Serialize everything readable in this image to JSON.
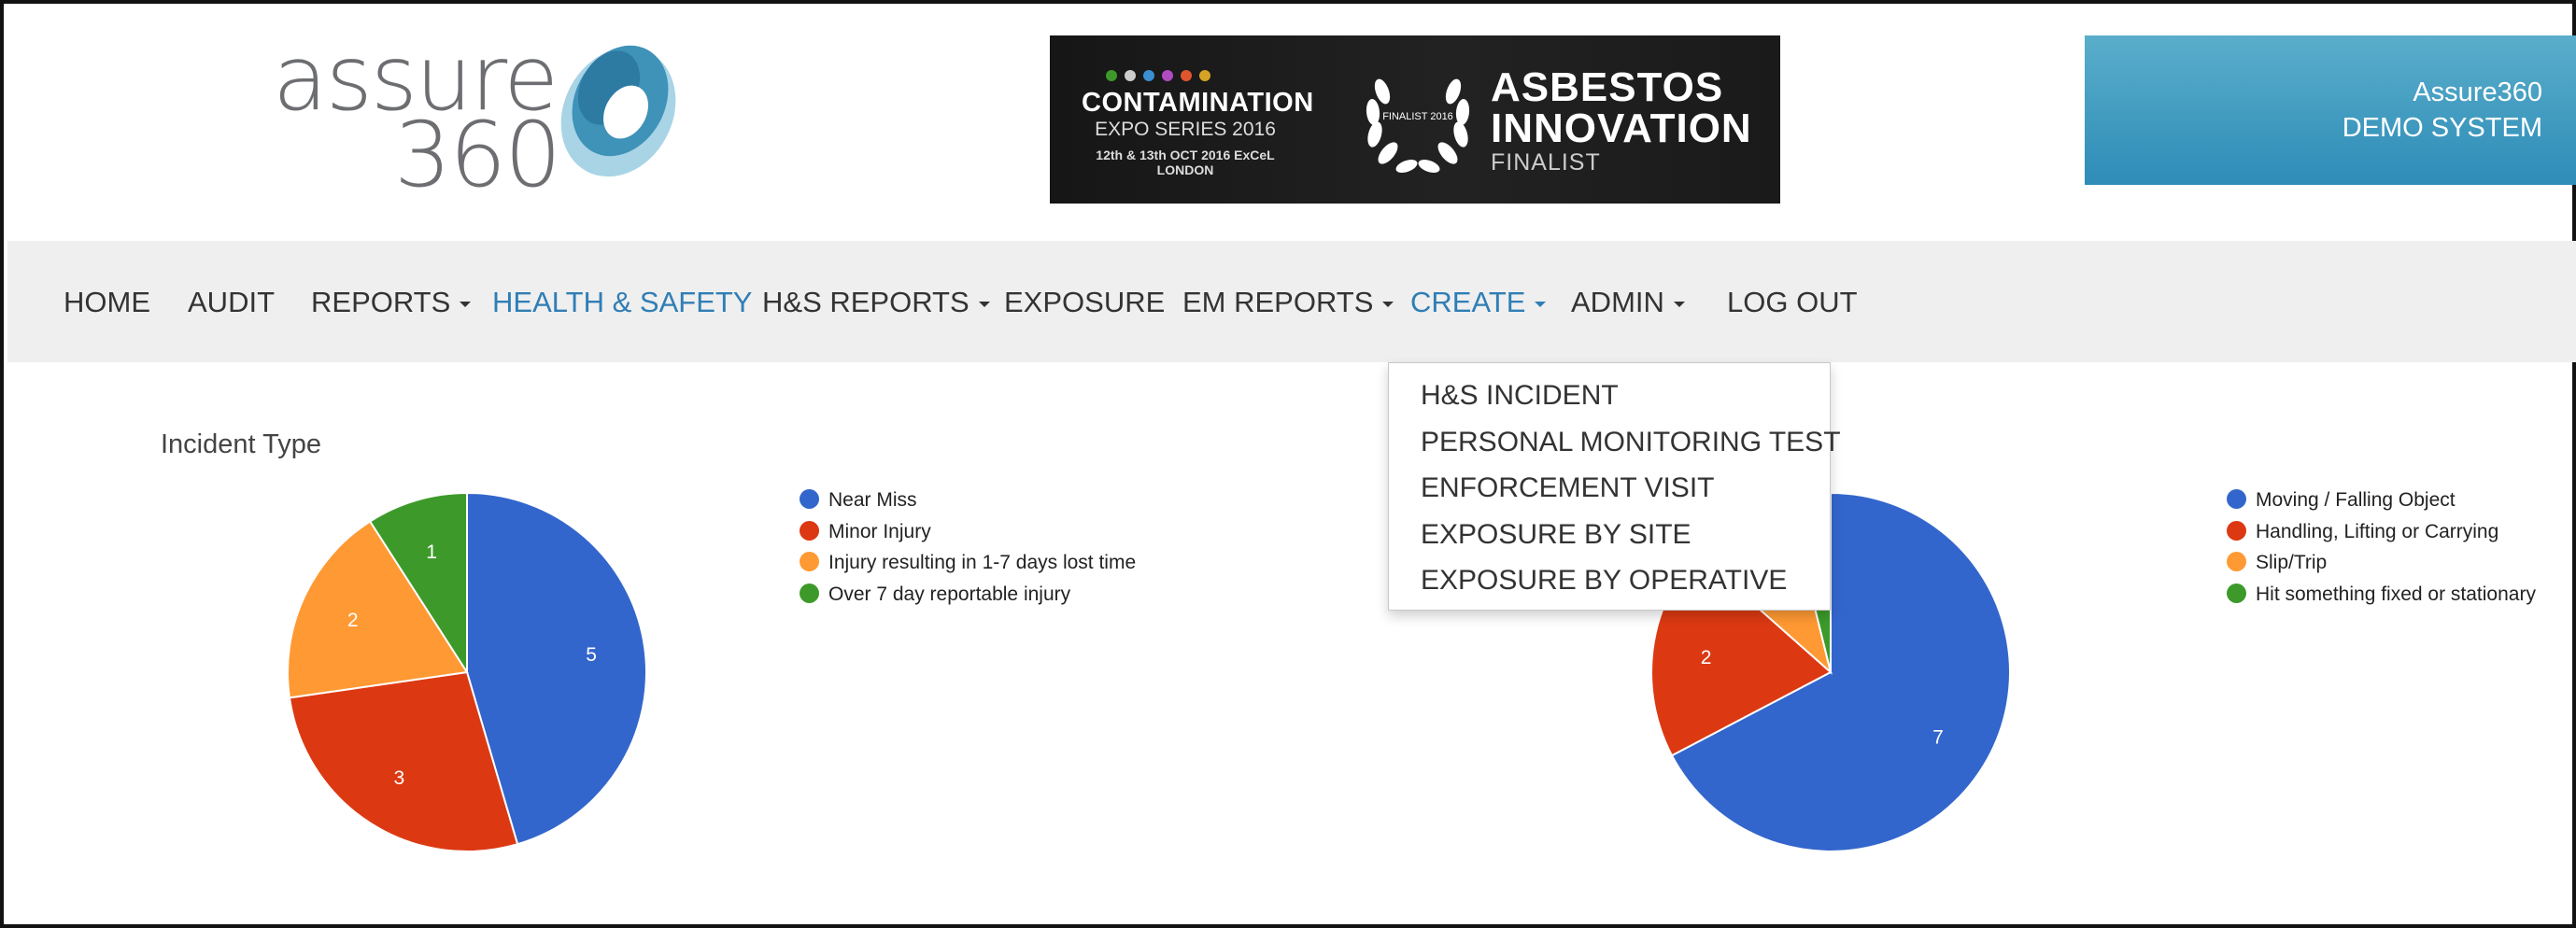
{
  "header": {
    "logo_word": "assure",
    "logo_number": "360",
    "banner": {
      "expo_line1": "CONTAMINATION",
      "expo_line2": "EXPO SERIES 2016",
      "expo_line3": "12th & 13th OCT 2016 ExCeL LONDON",
      "wreath_text": "FINALIST 2016",
      "award_line1": "ASBESTOS",
      "award_line2": "INNOVATION",
      "award_line3": "FINALIST"
    },
    "demo_line1": "Assure360",
    "demo_line2": "DEMO SYSTEM"
  },
  "nav": {
    "items": [
      {
        "label": "HOME"
      },
      {
        "label": "AUDIT"
      },
      {
        "label": "REPORTS"
      },
      {
        "label": "HEALTH & SAFETY"
      },
      {
        "label": "H&S REPORTS"
      },
      {
        "label": "EXPOSURE"
      },
      {
        "label": "EM REPORTS"
      },
      {
        "label": "CREATE"
      },
      {
        "label": "ADMIN"
      },
      {
        "label": "LOG OUT"
      }
    ],
    "active": "HEALTH & SAFETY"
  },
  "create_menu": {
    "items": [
      {
        "label": "H&S INCIDENT"
      },
      {
        "label": "PERSONAL MONITORING TEST"
      },
      {
        "label": "ENFORCEMENT VISIT"
      },
      {
        "label": "EXPOSURE BY SITE"
      },
      {
        "label": "EXPOSURE BY OPERATIVE"
      }
    ]
  },
  "colors": {
    "blue": "#3366cc",
    "red": "#dc3912",
    "orange": "#ff9933",
    "green": "#3d9a2a",
    "accent": "#2f7eb5"
  },
  "chart_data": [
    {
      "type": "pie",
      "title": "Incident Type",
      "series": [
        {
          "name": "Near Miss",
          "value": 5
        },
        {
          "name": "Minor Injury",
          "value": 3
        },
        {
          "name": "Injury resulting in 1-7 days lost time",
          "value": 2
        },
        {
          "name": "Over 7 day reportable injury",
          "value": 1
        }
      ],
      "legend_position": "right"
    },
    {
      "type": "pie",
      "title": "",
      "series": [
        {
          "name": "Moving / Falling Object",
          "value": 7
        },
        {
          "name": "Handling, Lifting or Carrying",
          "value": 2
        },
        {
          "name": "Slip/Trip",
          "value": 1
        },
        {
          "name": "Hit something fixed or stationary",
          "value": 0.4
        }
      ],
      "legend_position": "right"
    }
  ]
}
